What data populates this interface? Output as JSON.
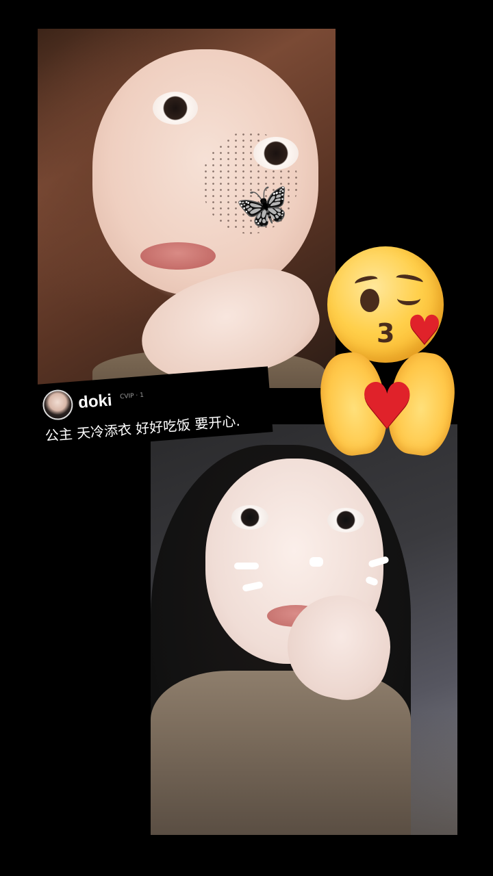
{
  "comment": {
    "username": "doki",
    "badge": "CVIP · 1",
    "text": "公主 天冷添衣 好好吃饭 要开心."
  },
  "stickers": {
    "kiss_emoji": "kissing-face-with-wink-icon",
    "hands_emoji": "open-palms-heart-icon",
    "heart_glyph": "♥"
  },
  "colors": {
    "background": "#000000",
    "heart": "#e0222a",
    "emoji_yellow": "#ffcf4a"
  }
}
